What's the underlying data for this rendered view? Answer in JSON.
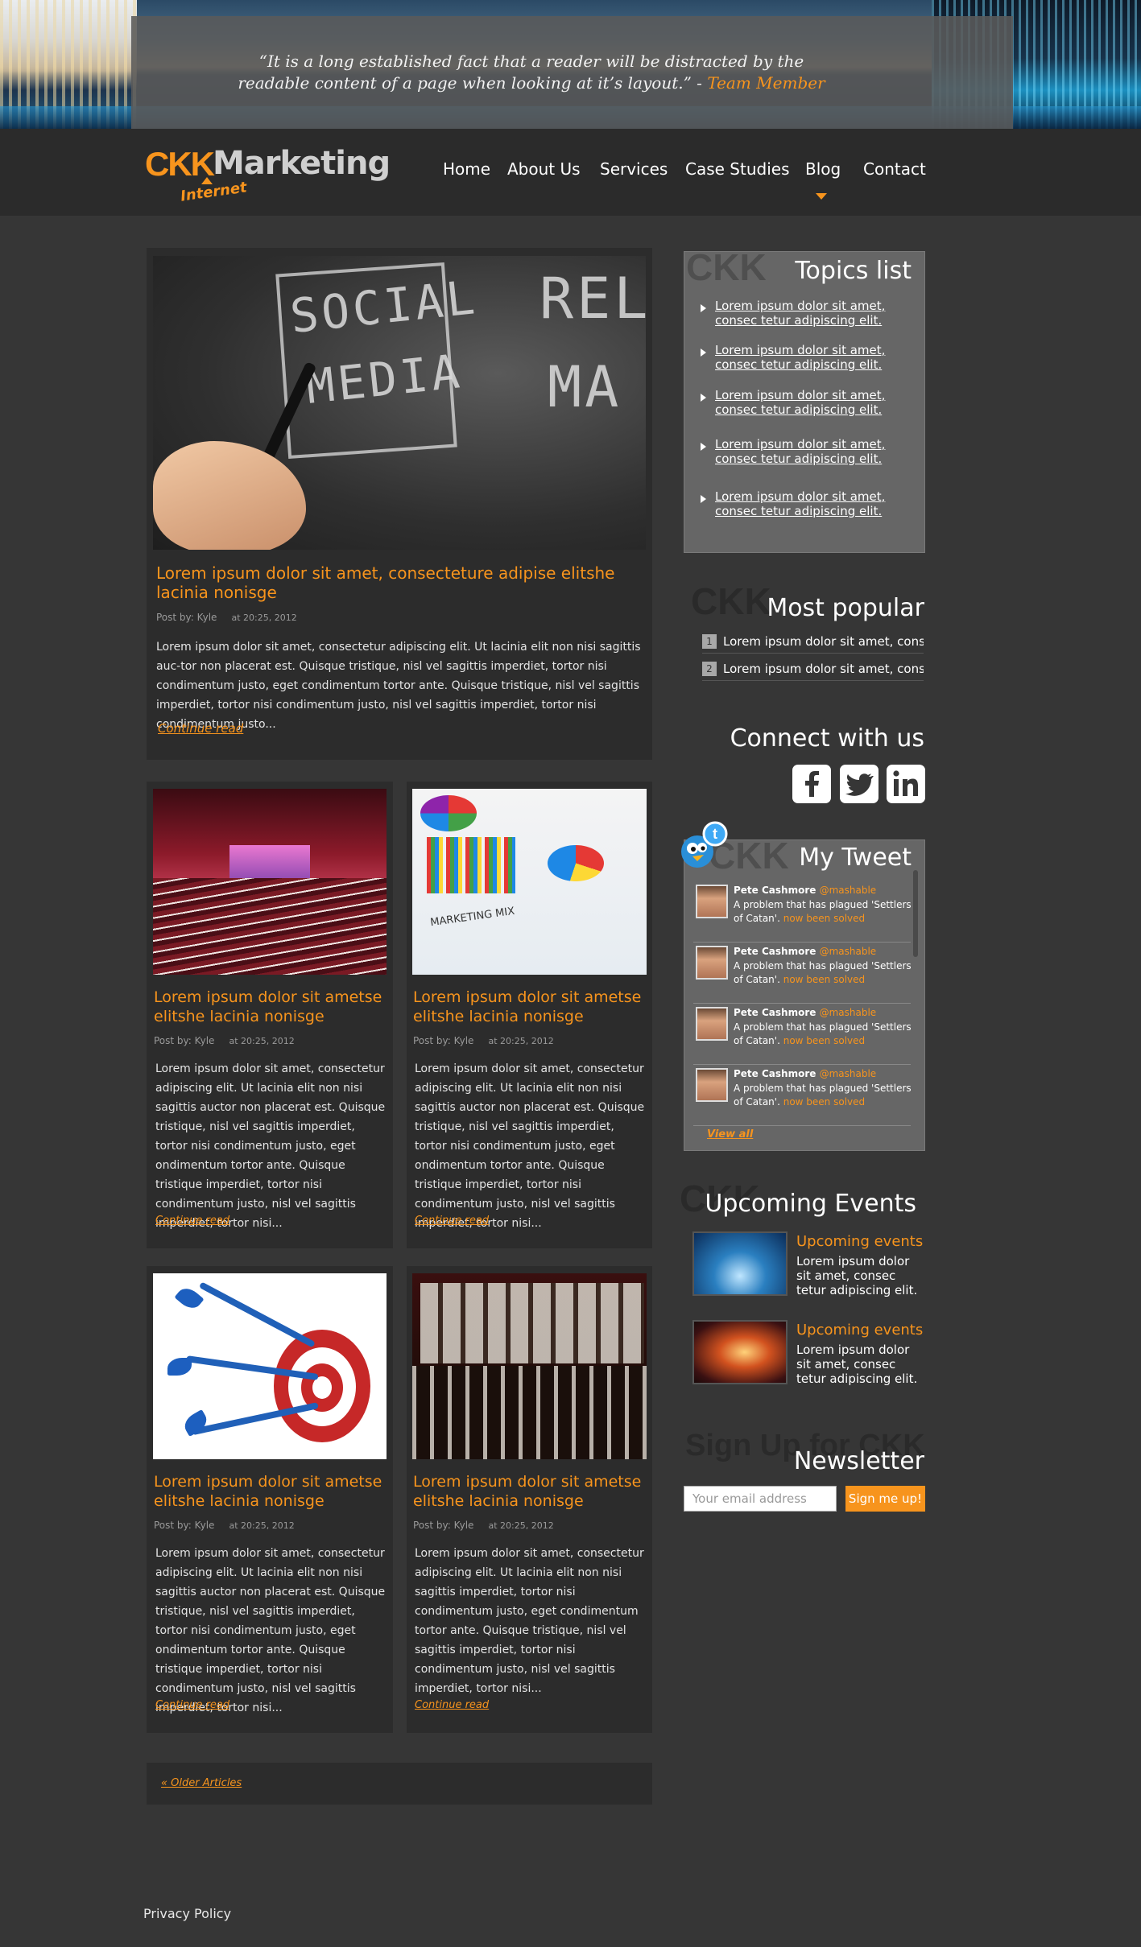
{
  "hero": {
    "quote": "“It is a long established fact that a reader will be distracted by the readable content of a page when looking at it’s layout.” - ",
    "author": "Team Member"
  },
  "logo": {
    "brand": "CKK",
    "name": "Marketing",
    "tagline": "Internet"
  },
  "nav": {
    "items": [
      "Home",
      "About Us",
      "Services",
      "Case Studies",
      "Blog",
      "Contact"
    ],
    "active": "Blog"
  },
  "featured": {
    "title": "Lorem ipsum dolor sit amet, consecteture adipise elitshe lacinia nonisge",
    "author": "Post by: Kyle",
    "date": "at 20:25, 2012",
    "body": "Lorem ipsum dolor sit amet, consectetur adipiscing elit. Ut lacinia elit non nisi sagittis auc-tor non placerat est. Quisque tristique, nisl vel sagittis imperdiet, tortor nisi condimentum justo, eget condimentum tortor ante. Quisque tristique, nisl vel sagittis imperdiet, tortor nisi condimentum justo, nisl vel sagittis imperdiet, tortor nisi condimentum justo...",
    "more": "Continue read",
    "chalk": [
      "SOCIAL",
      "MEDIA",
      "REL",
      "MA"
    ]
  },
  "posts": [
    {
      "title": "Lorem ipsum dolor sit ametse elitshe lacinia nonisge",
      "author": "Post by: Kyle",
      "date": "at 20:25, 2012",
      "body": "Lorem ipsum dolor sit amet, consectetur adipiscing elit. Ut lacinia elit non nisi sagittis auctor non placerat est. Quisque tristique, nisl vel sagittis imperdiet, tortor nisi condimentum justo, eget ondimentum tortor ante. Quisque tristique imperdiet, tortor nisi condimentum justo, nisl vel sagittis imperdiet, tortor nisi...",
      "more": "Continue read"
    },
    {
      "title": "Lorem ipsum dolor sit ametse elitshe lacinia nonisge",
      "author": "Post by: Kyle",
      "date": "at 20:25, 2012",
      "body": "Lorem ipsum dolor sit amet, consectetur adipiscing elit. Ut lacinia elit non nisi sagittis auctor non placerat est. Quisque tristique, nisl vel sagittis imperdiet, tortor nisi condimentum justo, eget ondimentum tortor ante. Quisque tristique imperdiet, tortor nisi condimentum justo, nisl vel sagittis imperdiet, tortor nisi...",
      "more": "Continue read",
      "image_text": "MARKETING MIX"
    },
    {
      "title": "Lorem ipsum dolor sit ametse elitshe lacinia nonisge",
      "author": "Post by: Kyle",
      "date": "at 20:25, 2012",
      "body": "Lorem ipsum dolor sit amet, consectetur adipiscing elit. Ut lacinia elit non nisi sagittis auctor non placerat est. Quisque tristique, nisl vel sagittis imperdiet, tortor nisi condimentum justo, eget ondimentum tortor ante. Quisque tristique imperdiet, tortor nisi condimentum justo, nisl vel sagittis imperdiet, tortor nisi...",
      "more": "Continue read"
    },
    {
      "title": "Lorem ipsum dolor sit ametse elitshe lacinia nonisge",
      "author": "Post by: Kyle",
      "date": "at 20:25, 2012",
      "body": "Lorem ipsum dolor sit amet, consectetur adipiscing elit. Ut lacinia elit non nisi sagittis imperdiet, tortor nisi condimentum justo, eget condimentum tortor ante. Quisque tristique, nisl vel sagittis imperdiet, tortor nisi condimentum justo, nisl vel sagittis imperdiet, tortor nisi...",
      "more": "Continue read"
    }
  ],
  "older": "« Older Articles",
  "sidebar": {
    "ghost": "CKK",
    "topics": {
      "title": "Topics list",
      "items": [
        "Lorem ipsum dolor sit amet, consec tetur adipiscing elit.",
        "Lorem ipsum dolor sit amet, consec tetur adipiscing elit.",
        "Lorem ipsum dolor sit amet, consec tetur adipiscing elit.",
        "Lorem ipsum dolor sit amet, consec tetur adipiscing elit.",
        "Lorem ipsum dolor sit amet, consec tetur adipiscing elit."
      ]
    },
    "popular": {
      "title": "Most popular",
      "items": [
        {
          "num": "1",
          "text": "Lorem ipsum dolor sit amet, consec"
        },
        {
          "num": "2",
          "text": "Lorem ipsum dolor sit amet, consec"
        }
      ]
    },
    "connect": {
      "title": "Connect with us",
      "icons": [
        "facebook-icon",
        "twitter-icon",
        "linkedin-icon"
      ]
    },
    "tweets": {
      "title": "My Tweet",
      "items": [
        {
          "name": "Pete Cashmore",
          "handle": "@mashable",
          "text": "A problem that has plagued 'Settlers of Catan'.",
          "link": "now been solved"
        },
        {
          "name": "Pete Cashmore",
          "handle": "@mashable",
          "text": "A problem that has plagued 'Settlers of Catan'.",
          "link": "now been solved"
        },
        {
          "name": "Pete Cashmore",
          "handle": "@mashable",
          "text": "A problem that has plagued 'Settlers of Catan'.",
          "link": "now been solved"
        },
        {
          "name": "Pete Cashmore",
          "handle": "@mashable",
          "text": "A problem that has plagued 'Settlers of Catan'.",
          "link": "now been solved"
        }
      ],
      "view_all": "View  all"
    },
    "events": {
      "title": "Upcoming Events",
      "items": [
        {
          "title": "Upcoming events",
          "text": "Lorem ipsum dolor sit amet, consec tetur adipiscing elit."
        },
        {
          "title": "Upcoming events",
          "text": "Lorem ipsum dolor sit amet, consec tetur adipiscing elit."
        }
      ]
    },
    "newsletter": {
      "ghost": "Sign Up for CKK",
      "title": "Newsletter",
      "placeholder": "Your email address",
      "button": "Sign me up!"
    }
  },
  "footer": {
    "privacy": "Privacy Policy"
  },
  "colors": {
    "accent": "#f7941d",
    "background": "#363636",
    "panel": "#2c2c2c",
    "sidebar_panel": "#666666"
  }
}
